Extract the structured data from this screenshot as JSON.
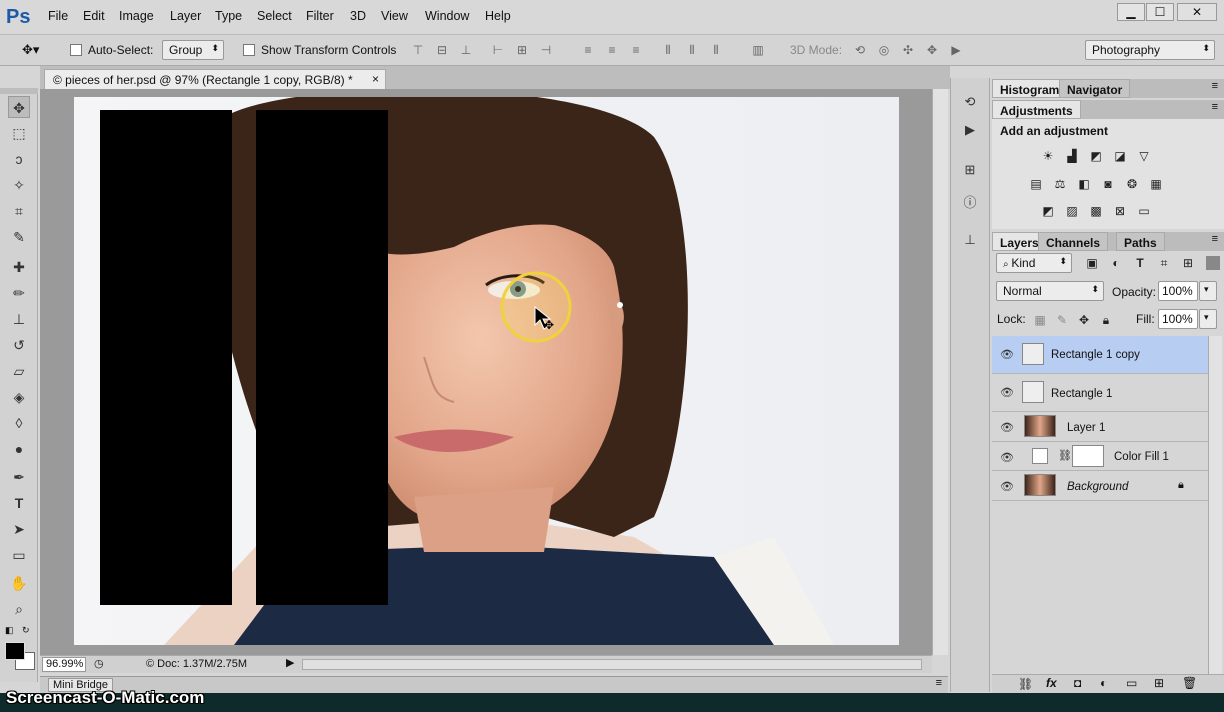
{
  "app": {
    "logo": "Ps"
  },
  "menu": [
    "File",
    "Edit",
    "Image",
    "Layer",
    "Type",
    "Select",
    "Filter",
    "3D",
    "View",
    "Window",
    "Help"
  ],
  "window_controls": {
    "minimize": "▁",
    "maximize": "☐",
    "close": "✕"
  },
  "options_bar": {
    "auto_select_label": "Auto-Select:",
    "auto_select_value": "Group",
    "show_transform_label": "Show Transform Controls",
    "mode_3d_label": "3D Mode:",
    "workspace": "Photography"
  },
  "document": {
    "tab_title": "© pieces of her.psd @ 97% (Rectangle 1 copy, RGB/8) *",
    "close": "×",
    "zoom": "96.99%",
    "doc_info": "© Doc: 1.37M/2.75M"
  },
  "mini_bridge": {
    "label": "Mini Bridge"
  },
  "panels": {
    "histogram_tab": "Histogram",
    "navigator_tab": "Navigator",
    "adjustments_tab": "Adjustments",
    "add_adjustment": "Add an adjustment",
    "layers_tab": "Layers",
    "channels_tab": "Channels",
    "paths_tab": "Paths",
    "kind_filter": "Kind",
    "blend_mode": "Normal",
    "opacity_label": "Opacity:",
    "opacity_value": "100%",
    "lock_label": "Lock:",
    "fill_label": "Fill:",
    "fill_value": "100%"
  },
  "layers": [
    {
      "name": "Rectangle 1 copy",
      "selected": true,
      "type": "shape"
    },
    {
      "name": "Rectangle 1",
      "selected": false,
      "type": "shape"
    },
    {
      "name": "Layer 1",
      "selected": false,
      "type": "photo"
    },
    {
      "name": "Color Fill 1",
      "selected": false,
      "type": "fill"
    },
    {
      "name": "Background",
      "selected": false,
      "type": "photo",
      "locked": true
    }
  ],
  "watermark": "Screencast-O-Matic.com",
  "colors": {
    "selection": "#b8cdf2",
    "accent": "#1c5aa8"
  }
}
